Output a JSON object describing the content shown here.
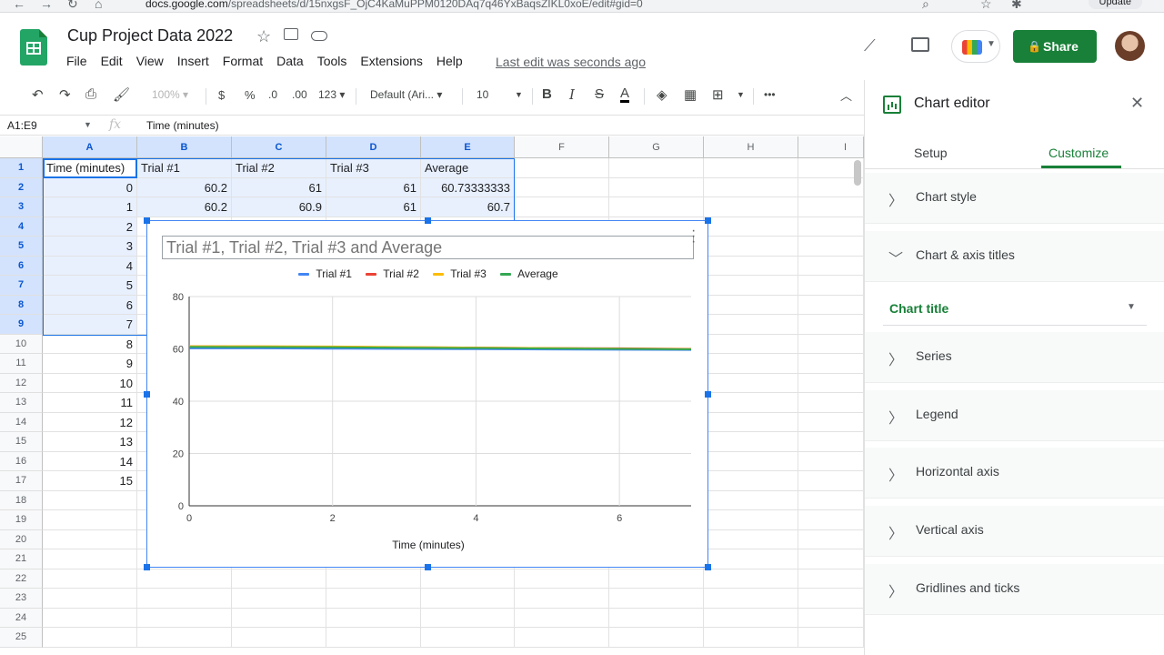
{
  "browser": {
    "url_host": "docs.google.com",
    "url_path": "/spreadsheets/d/15nxgsF_OjC4KaMuPPM0120DAq7q46YxBaqsZIKL0xoE/edit#gid=0",
    "update_label": "Update"
  },
  "header": {
    "doc_title": "Cup Project Data 2022",
    "menu": [
      "File",
      "Edit",
      "View",
      "Insert",
      "Format",
      "Data",
      "Tools",
      "Extensions",
      "Help"
    ],
    "last_edit": "Last edit was seconds ago",
    "share_label": "Share"
  },
  "toolbar": {
    "zoom": "100%",
    "currency": "$",
    "percent": "%",
    "dec_decrease": ".0",
    "dec_increase": ".00",
    "more_formats": "123",
    "font": "Default (Ari...",
    "font_size": "10",
    "bold": "B",
    "italic": "I",
    "strike": "S",
    "text_color": "A",
    "more": "•••"
  },
  "formula_bar": {
    "name_box": "A1:E9",
    "fx": "fx",
    "value": "Time (minutes)"
  },
  "sheet": {
    "columns": [
      "A",
      "B",
      "C",
      "D",
      "E",
      "F",
      "G",
      "H",
      "I"
    ],
    "row_numbers": [
      "1",
      "2",
      "3",
      "4",
      "5",
      "6",
      "7",
      "8",
      "9",
      "10",
      "11",
      "12",
      "13",
      "14",
      "15",
      "16",
      "17",
      "18",
      "19",
      "20",
      "21",
      "22",
      "23",
      "24",
      "25"
    ],
    "headers": [
      "Time (minutes)",
      "Trial #1",
      "Trial #2",
      "Trial #3",
      "Average"
    ],
    "row2": [
      "0",
      "60.2",
      "61",
      "61",
      "60.73333333"
    ],
    "row3": [
      "1",
      "60.2",
      "60.9",
      "61",
      "60.7"
    ],
    "col_a": [
      "2",
      "3",
      "4",
      "5",
      "6",
      "7",
      "8",
      "9",
      "10",
      "11",
      "12",
      "13",
      "14",
      "15"
    ]
  },
  "chart_data": {
    "type": "line",
    "title": "Trial #1, Trial #2, Trial #3 and Average",
    "xlabel": "Time (minutes)",
    "ylabel": "",
    "x": [
      0,
      1,
      2,
      3,
      4,
      5,
      6,
      7
    ],
    "xlim": [
      0,
      7
    ],
    "ylim": [
      0,
      80
    ],
    "x_ticks": [
      "0",
      "2",
      "4",
      "6"
    ],
    "y_ticks": [
      "0",
      "20",
      "40",
      "60",
      "80"
    ],
    "legend_position": "top",
    "grid": true,
    "series": [
      {
        "name": "Trial #1",
        "color": "#4285f4",
        "values": [
          60.2,
          60.2,
          60.1,
          60.0,
          59.9,
          59.8,
          59.7,
          59.6
        ]
      },
      {
        "name": "Trial #2",
        "color": "#ea4335",
        "values": [
          61,
          60.9,
          60.8,
          60.6,
          60.5,
          60.3,
          60.2,
          60.0
        ]
      },
      {
        "name": "Trial #3",
        "color": "#fbbc04",
        "values": [
          61,
          61,
          60.9,
          60.7,
          60.5,
          60.3,
          60.1,
          59.9
        ]
      },
      {
        "name": "Average",
        "color": "#34a853",
        "values": [
          60.73,
          60.7,
          60.6,
          60.43,
          60.3,
          60.13,
          60.0,
          59.83
        ]
      }
    ]
  },
  "panel": {
    "title": "Chart editor",
    "tabs": [
      "Setup",
      "Customize"
    ],
    "sections": [
      "Chart style",
      "Chart & axis titles",
      "Series",
      "Legend",
      "Horizontal axis",
      "Vertical axis",
      "Gridlines and ticks"
    ],
    "title_select": "Chart title"
  },
  "colors": {
    "accent": "#188038",
    "selection": "#1a73e8"
  }
}
